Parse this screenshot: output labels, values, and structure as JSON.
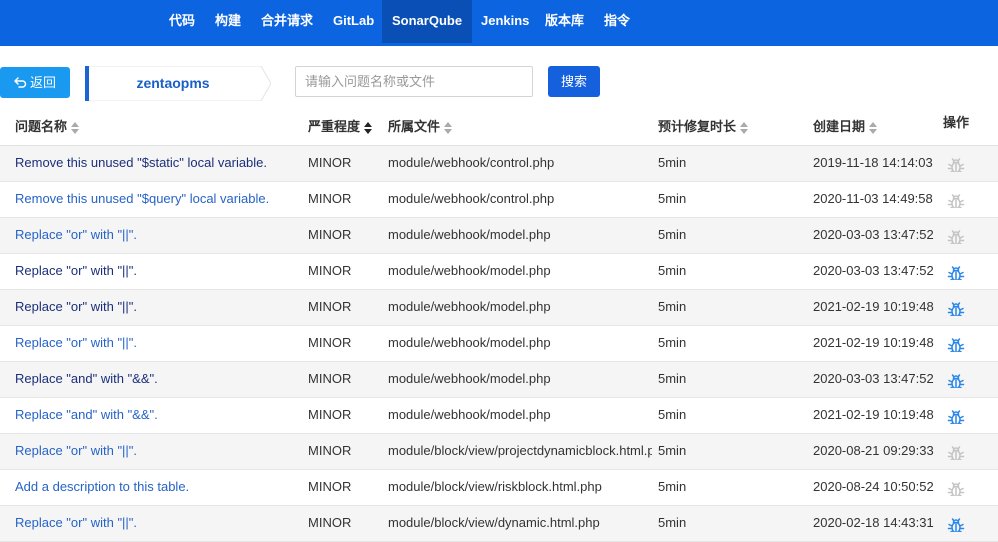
{
  "nav": {
    "items": [
      {
        "label": "代码"
      },
      {
        "label": "构建"
      },
      {
        "label": "合并请求"
      },
      {
        "label": "GitLab"
      },
      {
        "label": "SonarQube",
        "active": true
      },
      {
        "label": "Jenkins"
      },
      {
        "label": "版本库"
      },
      {
        "label": "指令"
      }
    ]
  },
  "toolbar": {
    "back_label": "返回",
    "project_name": "zentaopms",
    "search_placeholder": "请输入问题名称或文件",
    "search_label": "搜索"
  },
  "table": {
    "headers": {
      "name": "问题名称",
      "severity": "严重程度",
      "file": "所属文件",
      "time": "预计修复时长",
      "date": "创建日期",
      "action": "操作"
    },
    "rows": [
      {
        "name": "Remove this unused \"$static\" local variable.",
        "severity": "MINOR",
        "file": "module/webhook/control.php",
        "time": "5min",
        "date": "2019-11-18 14:14:03",
        "bug_active": false,
        "link_style": "dark"
      },
      {
        "name": "Remove this unused \"$query\" local variable.",
        "severity": "MINOR",
        "file": "module/webhook/control.php",
        "time": "5min",
        "date": "2020-11-03 14:49:58",
        "bug_active": false,
        "link_style": "blue"
      },
      {
        "name": "Replace \"or\" with \"||\".",
        "severity": "MINOR",
        "file": "module/webhook/model.php",
        "time": "5min",
        "date": "2020-03-03 13:47:52",
        "bug_active": false,
        "link_style": "blue"
      },
      {
        "name": "Replace \"or\" with \"||\".",
        "severity": "MINOR",
        "file": "module/webhook/model.php",
        "time": "5min",
        "date": "2020-03-03 13:47:52",
        "bug_active": true,
        "link_style": "dark"
      },
      {
        "name": "Replace \"or\" with \"||\".",
        "severity": "MINOR",
        "file": "module/webhook/model.php",
        "time": "5min",
        "date": "2021-02-19 10:19:48",
        "bug_active": true,
        "link_style": "dark"
      },
      {
        "name": "Replace \"or\" with \"||\".",
        "severity": "MINOR",
        "file": "module/webhook/model.php",
        "time": "5min",
        "date": "2021-02-19 10:19:48",
        "bug_active": true,
        "link_style": "blue"
      },
      {
        "name": "Replace \"and\" with \"&&\".",
        "severity": "MINOR",
        "file": "module/webhook/model.php",
        "time": "5min",
        "date": "2020-03-03 13:47:52",
        "bug_active": true,
        "link_style": "dark"
      },
      {
        "name": "Replace \"and\" with \"&&\".",
        "severity": "MINOR",
        "file": "module/webhook/model.php",
        "time": "5min",
        "date": "2021-02-19 10:19:48",
        "bug_active": true,
        "link_style": "blue"
      },
      {
        "name": "Replace \"or\" with \"||\".",
        "severity": "MINOR",
        "file": "module/block/view/projectdynamicblock.html.php",
        "time": "5min",
        "date": "2020-08-21 09:29:33",
        "bug_active": false,
        "link_style": "blue"
      },
      {
        "name": "Add a description to this table.",
        "severity": "MINOR",
        "file": "module/block/view/riskblock.html.php",
        "time": "5min",
        "date": "2020-08-24 10:50:52",
        "bug_active": false,
        "link_style": "blue"
      },
      {
        "name": "Replace \"or\" with \"||\".",
        "severity": "MINOR",
        "file": "module/block/view/dynamic.html.php",
        "time": "5min",
        "date": "2020-02-18 14:43:31",
        "bug_active": true,
        "link_style": "blue"
      }
    ]
  },
  "colors": {
    "nav_bg": "#0c64e0",
    "nav_active": "#0a4fb6",
    "back_button": "#1a99f1",
    "search_button": "#1560dc",
    "bug_active": "#2a86e8",
    "bug_inactive": "#c4c4c4"
  },
  "icons": {
    "back": "return-arrow-icon",
    "action": "bug-icon",
    "sort": "sort-icon"
  }
}
